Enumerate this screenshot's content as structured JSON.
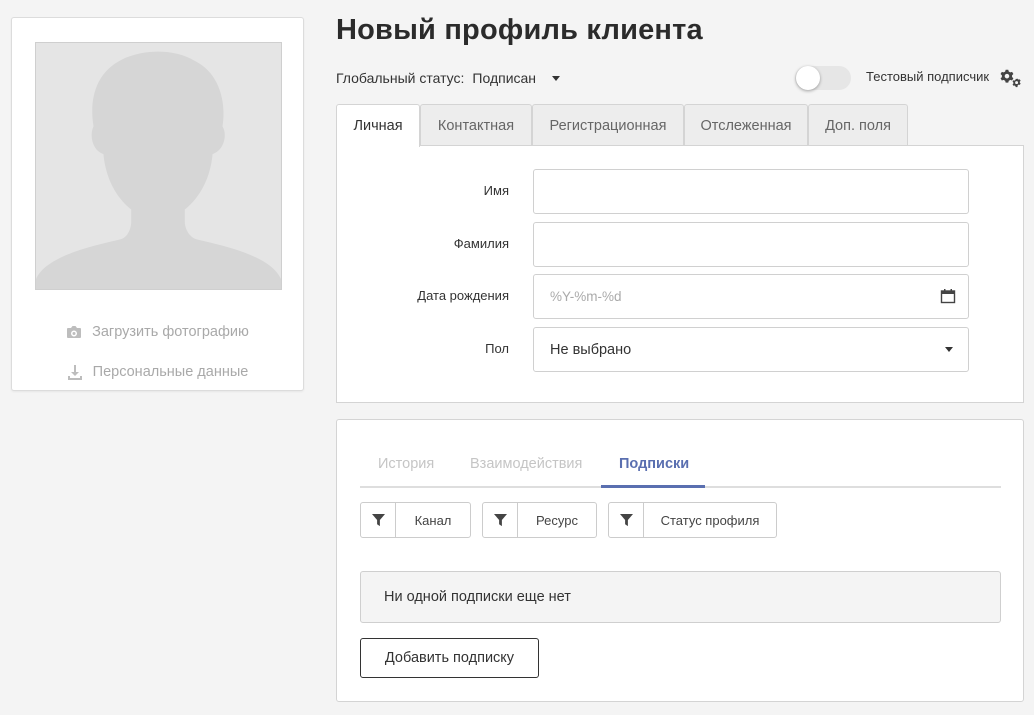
{
  "left_card": {
    "upload_photo_label": "Загрузить фотографию",
    "personal_data_label": "Персональные данные"
  },
  "header": {
    "title": "Новый профиль клиента",
    "global_status_label": "Глобальный статус:",
    "global_status_value": "Подписан",
    "test_subscriber_label": "Тестовый подписчик",
    "test_subscriber_enabled": false
  },
  "tabs": [
    {
      "label": "Личная",
      "active": true
    },
    {
      "label": "Контактная",
      "active": false
    },
    {
      "label": "Регистрационная",
      "active": false
    },
    {
      "label": "Отслеженная",
      "active": false
    },
    {
      "label": "Доп. поля",
      "active": false
    }
  ],
  "form": {
    "first_name": {
      "label": "Имя",
      "value": ""
    },
    "last_name": {
      "label": "Фамилия",
      "value": ""
    },
    "birth_date": {
      "label": "Дата рождения",
      "placeholder": "%Y-%m-%d"
    },
    "gender": {
      "label": "Пол",
      "value": "Не выбрано"
    }
  },
  "subscriptions": {
    "tabs": [
      {
        "label": "История",
        "active": false
      },
      {
        "label": "Взаимодействия",
        "active": false
      },
      {
        "label": "Подписки",
        "active": true
      }
    ],
    "filters": [
      {
        "label": "Канал"
      },
      {
        "label": "Ресурс"
      },
      {
        "label": "Статус профиля"
      }
    ],
    "empty_message": "Ни одной подписки еще нет",
    "add_button_label": "Добавить подписку"
  },
  "colors": {
    "accent": "#5a6fb0",
    "background": "#f4f4f4"
  }
}
